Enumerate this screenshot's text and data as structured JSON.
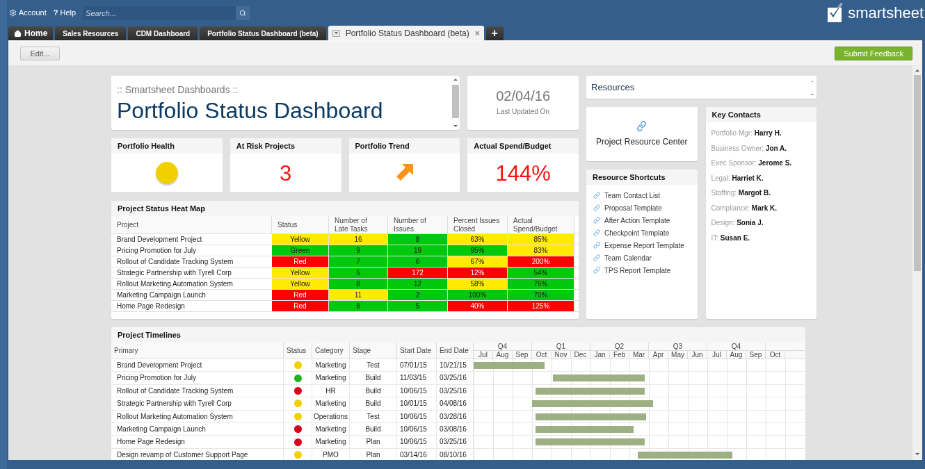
{
  "topbar": {
    "account": "Account",
    "help_icon": "?",
    "help": "Help",
    "search": {
      "placeholder": "Search..."
    },
    "logo": "smartsheet"
  },
  "tabs": [
    {
      "label": "Home",
      "kind": "home",
      "selected": false
    },
    {
      "label": "Sales Resources",
      "kind": "tab",
      "selected": false
    },
    {
      "label": "CDM Dashboard",
      "kind": "tab",
      "selected": false
    },
    {
      "label": "Portfolio Status Dashboard (beta)",
      "kind": "tab",
      "selected": false
    },
    {
      "label": "Portfolio Status Dashboard (beta)",
      "kind": "tab",
      "selected": true
    },
    {
      "label": "+",
      "kind": "add",
      "selected": false
    }
  ],
  "close_tab": "×",
  "toolbar": {
    "edit": "Edit...",
    "feedback": "Submit Feedback"
  },
  "title_card": {
    "subtitle": ":: Smartsheet Dashboards ::",
    "title": "Portfolio Status Dashboard"
  },
  "date_card": {
    "date": "02/04/16",
    "caption": "Last Updated On"
  },
  "metrics": [
    {
      "title": "Portfolio Health",
      "kind": "indicator",
      "color": "#f2d000"
    },
    {
      "title": "At Risk Projects",
      "kind": "value",
      "value": "3"
    },
    {
      "title": "Portfolio Trend",
      "kind": "trend"
    },
    {
      "title": "Actual Spend/Budget",
      "kind": "value",
      "value": "144%"
    }
  ],
  "heat_map": {
    "title": "Project Status Heat Map",
    "columns": [
      "Project",
      "Status",
      "Number of Late Tasks",
      "Number of Issues",
      "Percent Issues Closed",
      "Actual Spend/Budget"
    ],
    "rows": [
      {
        "cells": [
          {
            "text": "Brand Development Project"
          },
          {
            "text": "Yellow",
            "color": "#ffea00"
          },
          {
            "text": "16",
            "color": "#ffea00"
          },
          {
            "text": "8",
            "color": "#00c90d"
          },
          {
            "text": "63%",
            "color": "#ffea00"
          },
          {
            "text": "85%",
            "color": "#ffea00"
          }
        ]
      },
      {
        "cells": [
          {
            "text": "Pricing Promotion for July"
          },
          {
            "text": "Green",
            "color": "#00c90d"
          },
          {
            "text": "9",
            "color": "#00c90d"
          },
          {
            "text": "19",
            "color": "#00c90d"
          },
          {
            "text": "95%",
            "color": "#00c90d"
          },
          {
            "text": "83%",
            "color": "#ffea00"
          }
        ]
      },
      {
        "cells": [
          {
            "text": "Rollout of Candidate Tracking System"
          },
          {
            "text": "Red",
            "color": "#ff0000"
          },
          {
            "text": "7",
            "color": "#00c90d"
          },
          {
            "text": "6",
            "color": "#00c90d"
          },
          {
            "text": "67%",
            "color": "#ffea00"
          },
          {
            "text": "200%",
            "color": "#ff0000"
          }
        ]
      },
      {
        "cells": [
          {
            "text": "Strategic Partnership with Tyrell Corp"
          },
          {
            "text": "Yellow",
            "color": "#ffea00"
          },
          {
            "text": "5",
            "color": "#00c90d"
          },
          {
            "text": "172",
            "color": "#ff0000"
          },
          {
            "text": "12%",
            "color": "#ff0000"
          },
          {
            "text": "54%",
            "color": "#00c90d"
          }
        ]
      },
      {
        "cells": [
          {
            "text": "Rollout Marketing Automation System"
          },
          {
            "text": "Yellow",
            "color": "#ffea00"
          },
          {
            "text": "8",
            "color": "#00c90d"
          },
          {
            "text": "12",
            "color": "#00c90d"
          },
          {
            "text": "58%",
            "color": "#ffea00"
          },
          {
            "text": "76%",
            "color": "#00c90d"
          }
        ]
      },
      {
        "cells": [
          {
            "text": "Marketing Campaign Launch"
          },
          {
            "text": "Red",
            "color": "#ff0000"
          },
          {
            "text": "11",
            "color": "#ffea00"
          },
          {
            "text": "2",
            "color": "#00c90d"
          },
          {
            "text": "100%",
            "color": "#00c90d"
          },
          {
            "text": "70%",
            "color": "#00c90d"
          }
        ]
      },
      {
        "cells": [
          {
            "text": "Home Page Redesign"
          },
          {
            "text": "Red",
            "color": "#ff0000"
          },
          {
            "text": "8",
            "color": "#00c90d"
          },
          {
            "text": "5",
            "color": "#00c90d"
          },
          {
            "text": "40%",
            "color": "#ff0000"
          },
          {
            "text": "125%",
            "color": "#ff0000"
          }
        ]
      }
    ]
  },
  "resources": {
    "title": "Resources",
    "center_link": "Project Resource Center",
    "shortcuts_title": "Resource Shortcuts",
    "shortcuts": [
      "Team Contact List",
      "Proposal Template",
      "After Action Template",
      "Checkpoint Template",
      "Expense Report Template",
      "Team Calendar",
      "TPS Report Template"
    ]
  },
  "key_contacts": {
    "title": "Key Contacts",
    "items": [
      "Portfolio Mgr: **Harry H.**",
      "Business Owner: **Jon A.**",
      "Exec Sponsor: **Jerome S.**",
      "Legal: **Harriet K.**",
      "Staffing: **Margot B.**",
      "Compliance: **Mark K.**",
      "Design: **Sonia J.**",
      "IT: **Susan E.**"
    ]
  },
  "timelines": {
    "title": "Project Timelines",
    "columns": [
      "Primary",
      "Status",
      "Category",
      "Stage",
      "Start Date",
      "End Date"
    ],
    "quarters": [
      "Q4",
      "Q1",
      "Q2",
      "Q3",
      "Q4"
    ],
    "months": [
      "Jul",
      "Aug",
      "Sep",
      "Oct",
      "Nov",
      "Dec",
      "Jan",
      "Feb",
      "Mar",
      "Apr",
      "May",
      "Jun",
      "Jul",
      "Aug",
      "Sep",
      "Oct"
    ],
    "rows": [
      {
        "name": "Brand Development Project",
        "color": "#f2d000",
        "category": "Marketing",
        "stage": "Test",
        "start": "07/01/15",
        "end": "10/21/15"
      },
      {
        "name": "Pricing Promotion for July",
        "color": "#1fb31f",
        "category": "Marketing",
        "stage": "Build",
        "start": "11/03/15",
        "end": "03/25/16"
      },
      {
        "name": "Rollout of Candidate Tracking System",
        "color": "#d9001b",
        "category": "HR",
        "stage": "Build",
        "start": "10/06/15",
        "end": "03/25/16"
      },
      {
        "name": "Strategic Partnership with Tyrell Corp",
        "color": "#f2d000",
        "category": "Marketing",
        "stage": "Build",
        "start": "10/01/15",
        "end": "04/08/16"
      },
      {
        "name": "Rollout Marketing Automation System",
        "color": "#f2d000",
        "category": "Operations",
        "stage": "Test",
        "start": "10/06/15",
        "end": "03/28/16"
      },
      {
        "name": "Marketing Campaign Launch",
        "color": "#d9001b",
        "category": "Marketing",
        "stage": "Build",
        "start": "10/06/15",
        "end": "03/08/16"
      },
      {
        "name": "Home Page Redesign",
        "color": "#d9001b",
        "category": "Marketing",
        "stage": "Plan",
        "start": "10/06/15",
        "end": "03/25/16"
      },
      {
        "name": "Design revamp of Customer Support Page",
        "color": "#f2d000",
        "category": "PMO",
        "stage": "Plan",
        "start": "03/14/16",
        "end": "08/10/16"
      }
    ]
  }
}
